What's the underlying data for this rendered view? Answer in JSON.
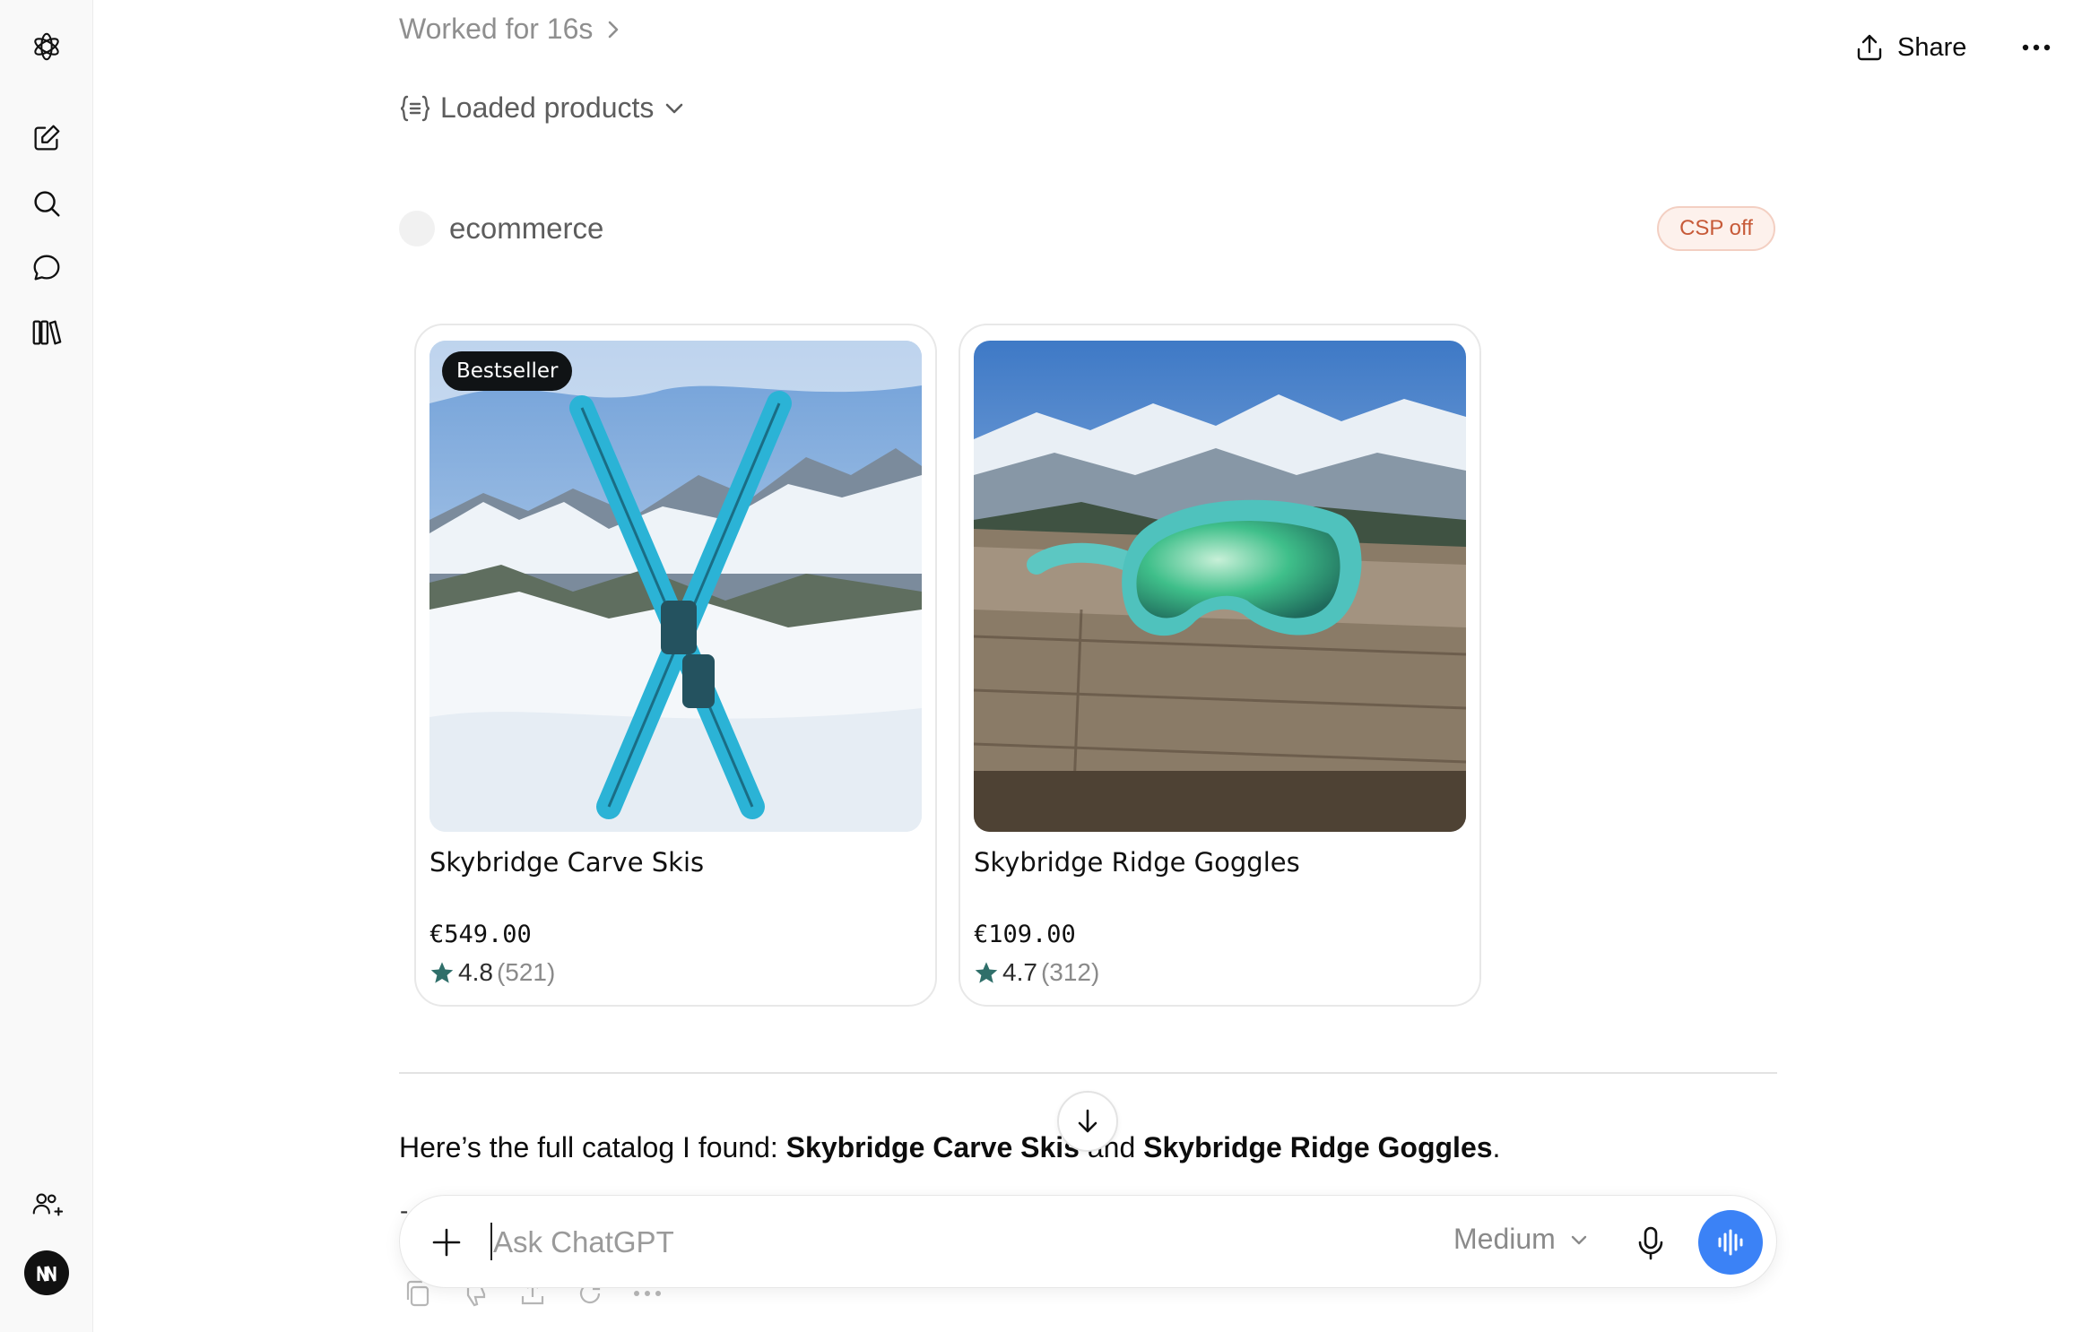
{
  "sidebar": {
    "logo_icon": "openai-logo-icon",
    "items": [
      {
        "name": "new-chat",
        "icon": "pencil-square-icon"
      },
      {
        "name": "search",
        "icon": "search-icon"
      },
      {
        "name": "chats",
        "icon": "chat-bubble-icon"
      },
      {
        "name": "library",
        "icon": "library-icon"
      }
    ],
    "bottom_icon": "add-people-icon",
    "avatar_icon": "avatar-logo-icon"
  },
  "header": {
    "share_label": "Share",
    "more_icon": "ellipsis-icon"
  },
  "activity": {
    "worked_label": "Worked for 16s",
    "loaded_label": "Loaded products"
  },
  "app": {
    "name": "ecommerce",
    "csp_badge": "CSP off"
  },
  "products": [
    {
      "badge": "Bestseller",
      "name": "Skybridge Carve Skis",
      "price": "€549.00",
      "rating": "4.8",
      "reviews": "(521)",
      "image": "turquoise skis crossed in snow with mountains"
    },
    {
      "badge": "",
      "name": "Skybridge Ridge Goggles",
      "price": "€109.00",
      "rating": "4.7",
      "reviews": "(312)",
      "image": "turquoise ski goggles on wooden table with mountains"
    }
  ],
  "message": {
    "prefix": "Here’s the full catalog I found: ",
    "item1": "Skybridge Carve Skis",
    "middle": " and ",
    "item2": "Skybridge Ridge Goggles",
    "suffix": "."
  },
  "composer": {
    "placeholder": "Ask ChatGPT",
    "model_label": "Medium"
  },
  "colors": {
    "accent_blue": "#3b82f6",
    "csp_text": "#c75a38",
    "star": "#2f6f6a"
  }
}
